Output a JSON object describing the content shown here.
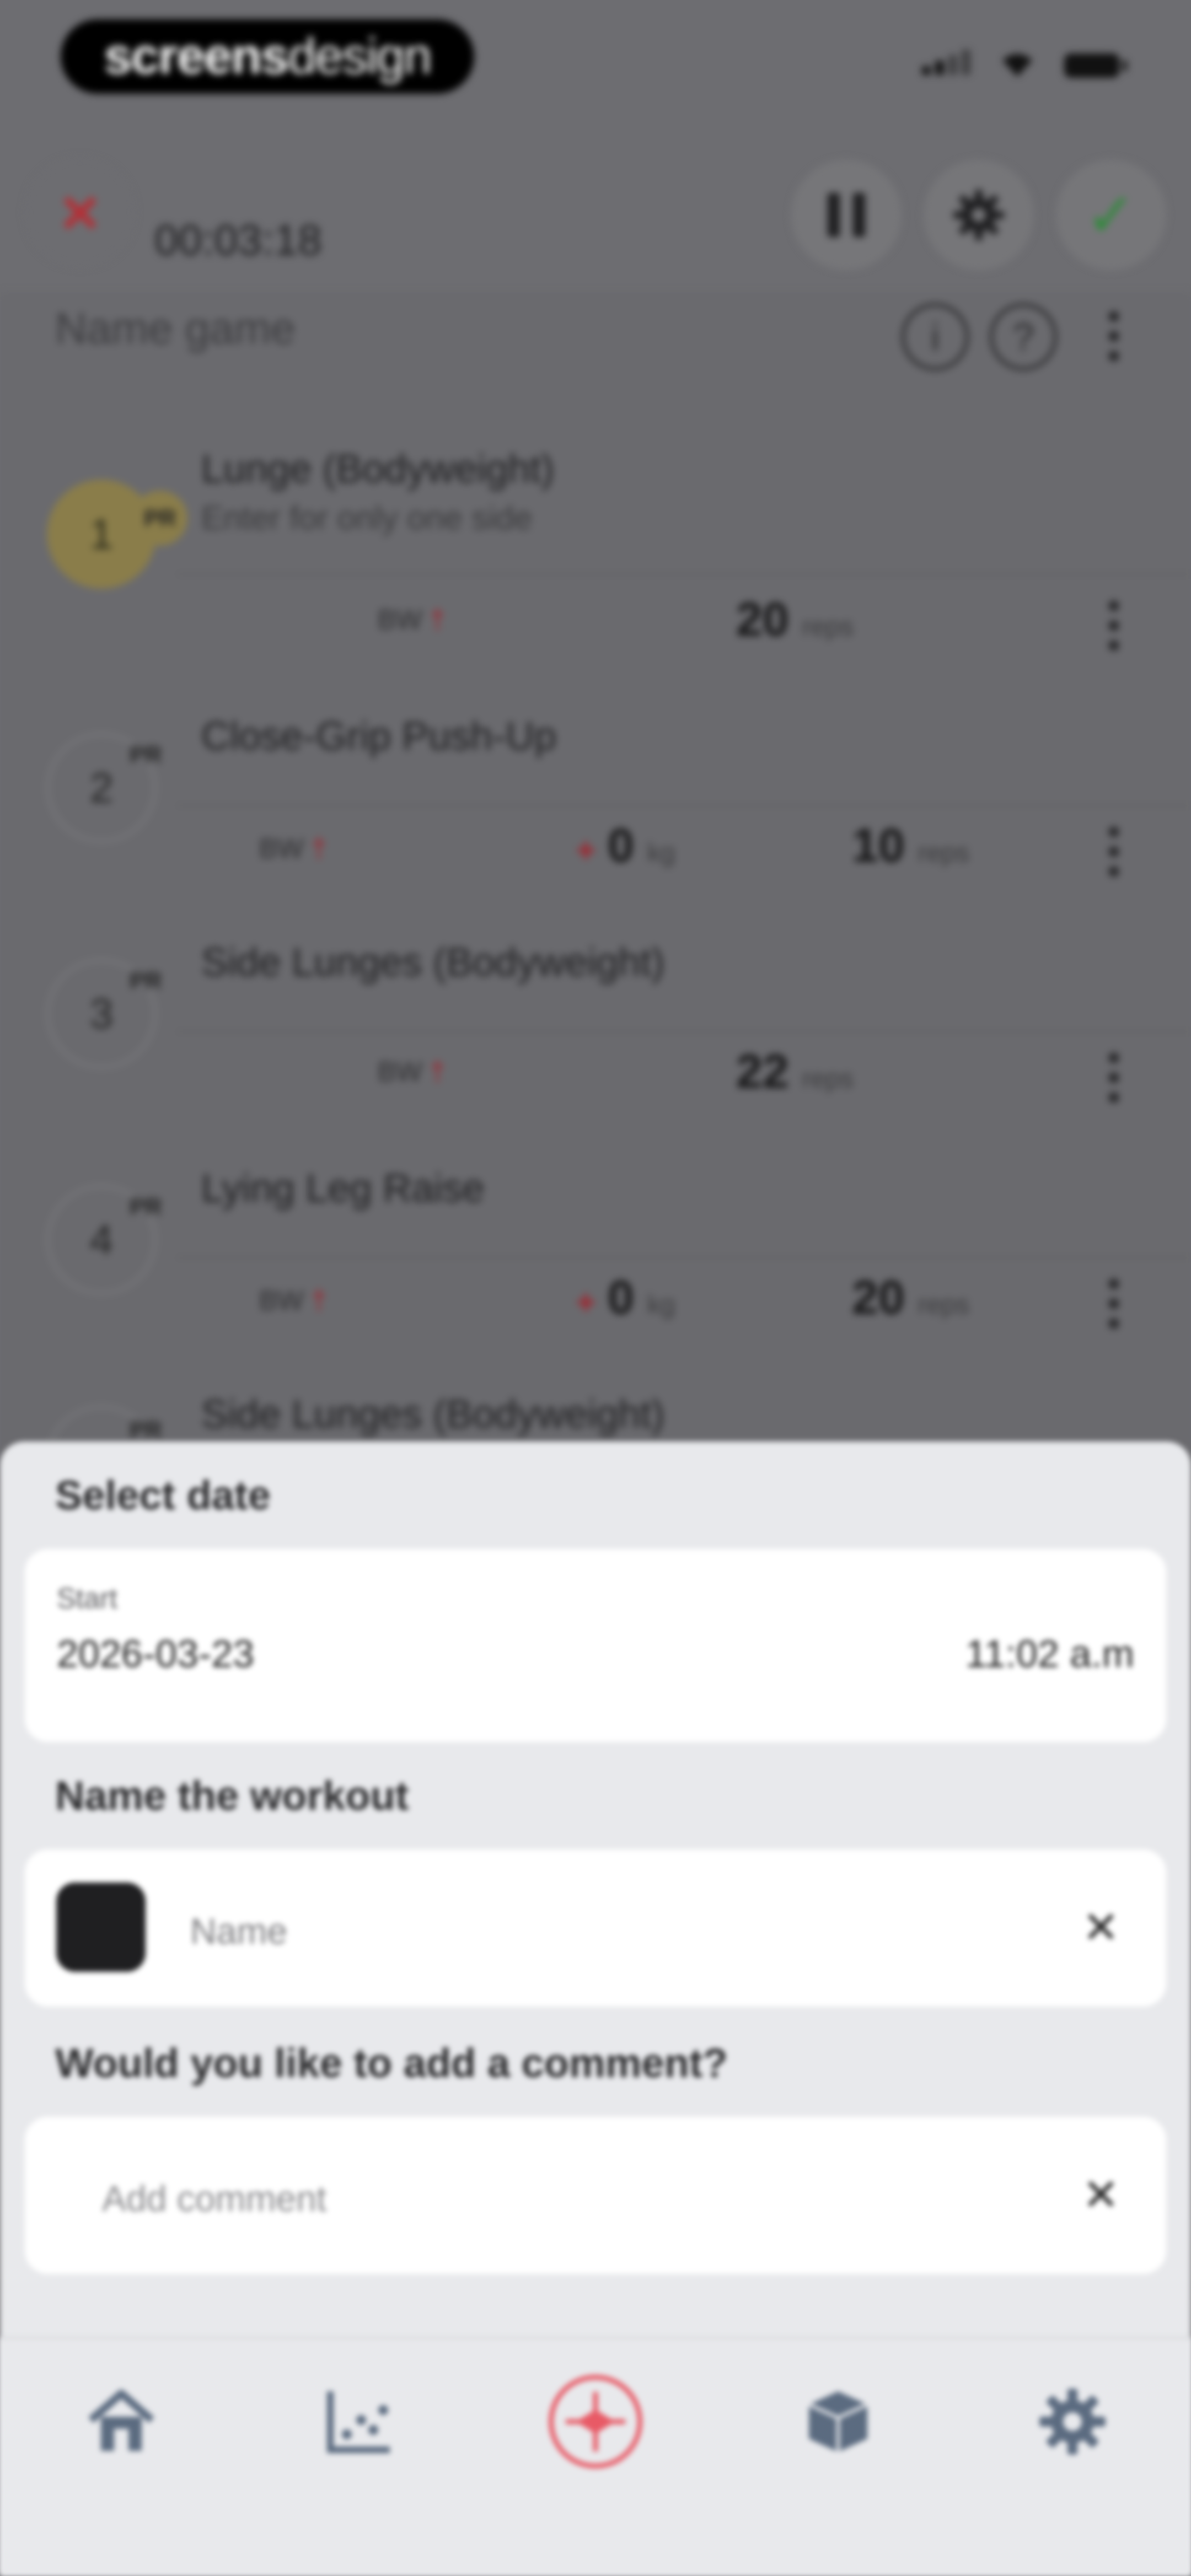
{
  "status_bar": {
    "logo_bold": "screens",
    "logo_light": "design"
  },
  "header": {
    "timer": "00:03:18",
    "close_icon": "close-icon",
    "pause_icon": "pause-icon",
    "settings_icon": "gear-icon",
    "confirm_icon": "checkmark-icon"
  },
  "workout": {
    "name_placeholder": "Name game"
  },
  "exercises": [
    {
      "number": "1",
      "pr": "PR",
      "name": "Lunge (Bodyweight)",
      "subtitle": "Enter for only one side",
      "bw": "BW",
      "weight": "",
      "weight_unit": "",
      "reps": "20",
      "reps_unit": "reps"
    },
    {
      "number": "2",
      "pr": "PR",
      "name": "Close-Grip Push-Up",
      "subtitle": "",
      "bw": "BW",
      "weight": "0",
      "weight_unit": "kg",
      "reps": "10",
      "reps_unit": "reps"
    },
    {
      "number": "3",
      "pr": "PR",
      "name": "Side Lunges (Bodyweight)",
      "subtitle": "",
      "bw": "BW",
      "weight": "",
      "weight_unit": "",
      "reps": "22",
      "reps_unit": "reps"
    },
    {
      "number": "4",
      "pr": "PR",
      "name": "Lying Leg Raise",
      "subtitle": "",
      "bw": "BW",
      "weight": "0",
      "weight_unit": "kg",
      "reps": "20",
      "reps_unit": "reps"
    },
    {
      "number": "",
      "pr": "PR",
      "name": "Side Lunges (Bodyweight)",
      "subtitle": ""
    }
  ],
  "sheet": {
    "date_title": "Select date",
    "start_label": "Start",
    "start_date": "2026-03-23",
    "start_time": "11:02 a.m",
    "name_title": "Name the workout",
    "name_placeholder": "Name",
    "comment_title": "Would you like to add a comment?",
    "comment_placeholder": "Add comment"
  },
  "tabbar": [
    {
      "icon": "home-icon",
      "color": "#5b6b80"
    },
    {
      "icon": "chart-icon",
      "color": "#5b6b80"
    },
    {
      "icon": "crosshair-icon",
      "color": "#e85a66",
      "active": true
    },
    {
      "icon": "box-icon",
      "color": "#5b6b80"
    },
    {
      "icon": "gear-icon",
      "color": "#5b6b80"
    }
  ],
  "colors": {
    "accent_red": "#e85a66",
    "confirm_green": "#2f8a3a",
    "close_red": "#b42f36"
  }
}
